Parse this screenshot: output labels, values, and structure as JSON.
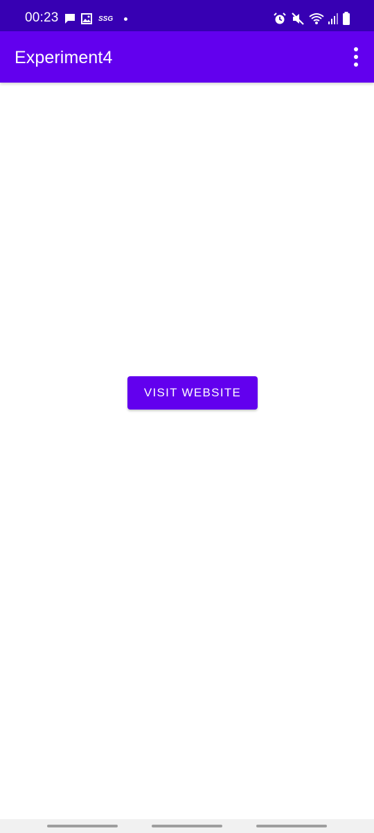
{
  "status_bar": {
    "time": "00:23",
    "carrier": "SSG",
    "left_icons": [
      "message-icon",
      "image-icon"
    ],
    "right_icons": [
      "alarm-icon",
      "mute-icon",
      "wifi-icon",
      "signal-icon",
      "battery-icon"
    ]
  },
  "app_bar": {
    "title": "Experiment4",
    "overflow_icon": "more-vert-icon"
  },
  "main": {
    "visit_button_label": "VISIT WEBSITE"
  },
  "colors": {
    "status_bar": "#3700B3",
    "primary": "#6200EE",
    "background": "#FFFFFF",
    "nav_bar": "#F1F1F1"
  }
}
